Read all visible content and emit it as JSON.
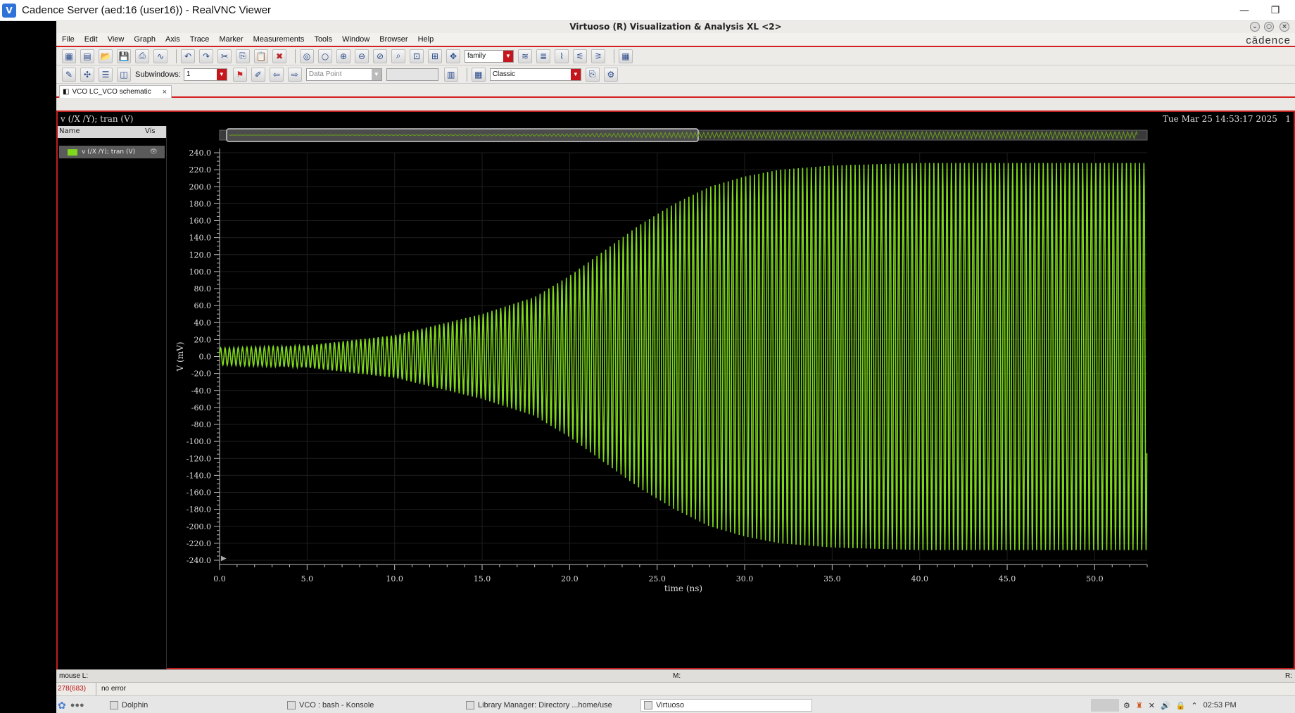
{
  "vnc": {
    "title": "Cadence Server (aed:16 (user16)) - RealVNC Viewer",
    "minimize": "—",
    "restore": "❐"
  },
  "app": {
    "title": "Virtuoso (R) Visualization & Analysis XL <2>",
    "brand": "cādence"
  },
  "menu": [
    "File",
    "Edit",
    "View",
    "Graph",
    "Axis",
    "Trace",
    "Marker",
    "Measurements",
    "Tools",
    "Window",
    "Browser",
    "Help"
  ],
  "toolbar": {
    "family_combo": "family",
    "subwindows_label": "Subwindows:",
    "subwindows_value": "1",
    "datapoint_placeholder": "Data Point",
    "style_combo": "Classic"
  },
  "tab": {
    "label": "VCO LC_VCO schematic",
    "close": "×"
  },
  "graph": {
    "trace_title": "v (/X /Y); tran (V)",
    "timestamp": "Tue Mar 25 14:53:17 2025",
    "subwindow_num": "1"
  },
  "legend": {
    "col_name": "Name",
    "col_vis": "Vis",
    "entry": "v (/X /Y); tran (V)"
  },
  "status": {
    "mouse_l": "mouse L:",
    "m": "M:",
    "r": "R:",
    "counter": "278(683)",
    "message": "no error"
  },
  "taskbar": {
    "items": [
      "Dolphin",
      "VCO : bash - Konsole",
      "Library Manager: Directory ...home/use",
      "Virtuoso"
    ],
    "clock": "02:53 PM"
  },
  "colors": {
    "trace": "#7fd71e",
    "frame": "#c21d1d",
    "background": "#000000"
  },
  "chart_data": {
    "type": "line",
    "title": "v (/X /Y); tran (V)",
    "xlabel": "time (ns)",
    "ylabel": "V (mV)",
    "xlim": [
      0,
      53
    ],
    "ylim": [
      -240,
      240
    ],
    "x_ticks": [
      "0.0",
      "5.0",
      "10.0",
      "15.0",
      "20.0",
      "25.0",
      "30.0",
      "35.0",
      "40.0",
      "45.0",
      "50.0"
    ],
    "y_ticks": [
      "240.0",
      "220.0",
      "200.0",
      "180.0",
      "160.0",
      "140.0",
      "120.0",
      "100.0",
      "80.0",
      "60.0",
      "40.0",
      "20.0",
      "0.0",
      "-20.0",
      "-40.0",
      "-60.0",
      "-80.0",
      "-100.0",
      "-120.0",
      "-140.0",
      "-160.0",
      "-180.0",
      "-200.0",
      "-220.0",
      "-240.0"
    ],
    "grid": true,
    "series": [
      {
        "name": "v (/X /Y); tran (V)",
        "envelope_time_ns": [
          0,
          5,
          10,
          15,
          18,
          20,
          22,
          24,
          26,
          28,
          30,
          32,
          35,
          40,
          45,
          50,
          53
        ],
        "envelope_amplitude_mV": [
          10,
          13,
          25,
          50,
          70,
          95,
          125,
          155,
          180,
          200,
          212,
          220,
          225,
          228,
          228,
          228,
          228
        ],
        "oscillation_period_ns": 0.25
      }
    ]
  }
}
